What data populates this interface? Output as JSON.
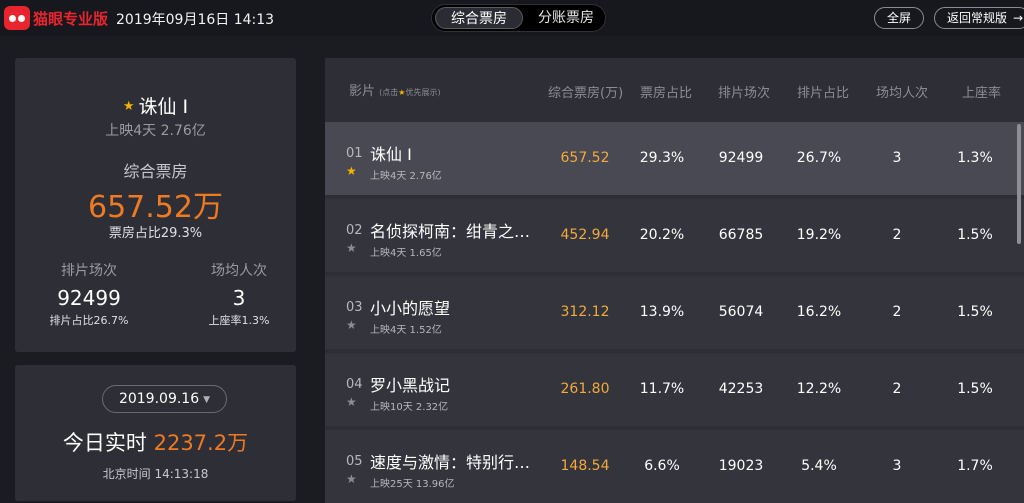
{
  "topbar": {
    "brand": "猫眼专业版",
    "datetime": "2019年09月16日 14:13",
    "tabs": [
      {
        "label": "综合票房",
        "active": true
      },
      {
        "label": "分账票房",
        "active": false
      }
    ],
    "fullscreen_label": "全屏",
    "back_label": "返回常规版",
    "back_arrow": "→"
  },
  "summary": {
    "star": "★",
    "title": "诛仙 I",
    "release_info": "上映4天 2.76亿",
    "gross_label": "综合票房",
    "gross_value": "657.52万",
    "share_text": "票房占比29.3%",
    "shows_label": "排片场次",
    "shows_value": "92499",
    "shows_share": "排片占比26.7%",
    "avg_label": "场均人次",
    "avg_value": "3",
    "seat_rate": "上座率1.3%"
  },
  "realtime": {
    "date": "2019.09.16",
    "dropdown_glyph": "▼",
    "label": "今日实时",
    "value": "2237.2万",
    "beijing_time": "北京时间 14:13:18"
  },
  "table": {
    "headers": {
      "film": "影片",
      "film_hint_pre": "(点击",
      "film_hint_star": "★",
      "film_hint_post": "优先展示)",
      "gross": "综合票房(万)",
      "gross_share": "票房占比",
      "shows": "排片场次",
      "shows_share": "排片占比",
      "avg": "场均人次",
      "seat": "上座率"
    },
    "rows": [
      {
        "rank": "01",
        "star": "★",
        "name": "诛仙 I",
        "sub": "上映4天  2.76亿",
        "gross": "657.52",
        "gross_share": "29.3%",
        "shows": "92499",
        "shows_share": "26.7%",
        "avg": "3",
        "seat": "1.3%"
      },
      {
        "rank": "02",
        "star": "★",
        "name": "名侦探柯南：绀青之…",
        "sub": "上映4天  1.65亿",
        "gross": "452.94",
        "gross_share": "20.2%",
        "shows": "66785",
        "shows_share": "19.2%",
        "avg": "2",
        "seat": "1.5%"
      },
      {
        "rank": "03",
        "star": "★",
        "name": "小小的愿望",
        "sub": "上映4天  1.52亿",
        "gross": "312.12",
        "gross_share": "13.9%",
        "shows": "56074",
        "shows_share": "16.2%",
        "avg": "2",
        "seat": "1.5%"
      },
      {
        "rank": "04",
        "star": "★",
        "name": "罗小黑战记",
        "sub": "上映10天  2.32亿",
        "gross": "261.80",
        "gross_share": "11.7%",
        "shows": "42253",
        "shows_share": "12.2%",
        "avg": "2",
        "seat": "1.5%"
      },
      {
        "rank": "05",
        "star": "★",
        "name": "速度与激情：特别行…",
        "sub": "上映25天  13.96亿",
        "gross": "148.54",
        "gross_share": "6.6%",
        "shows": "19023",
        "shows_share": "5.4%",
        "avg": "3",
        "seat": "1.7%"
      }
    ]
  },
  "colors": {
    "accent": "#f07a22",
    "gross_text": "#f3a93b",
    "star": "#f5b100",
    "brand": "#e8252f"
  }
}
